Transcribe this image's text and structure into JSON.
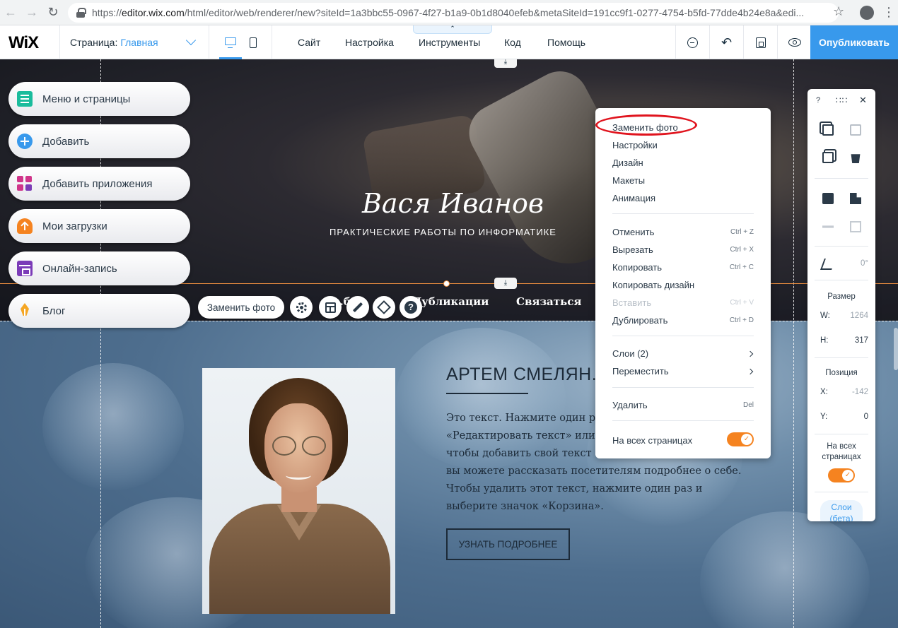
{
  "browser": {
    "url_scheme": "https://",
    "url_host": "editor.wix.com",
    "url_path": "/html/editor/web/renderer/new?siteId=1a3bbc55-0967-4f27-b1a9-0b1d8040efeb&metaSiteId=191cc9f1-0277-4754-b5fd-77dde4b24e8a&edi..."
  },
  "topbar": {
    "logo": "WiX",
    "page_label": "Страница:",
    "page_name": "Главная",
    "pull_tab": "⌃",
    "menu": [
      "Сайт",
      "Настройка",
      "Инструменты",
      "Код",
      "Помощь"
    ],
    "publish_label": "Опубликовать"
  },
  "sidebar": {
    "items": [
      {
        "label": "Меню и страницы",
        "icon": "pages-icon"
      },
      {
        "label": "Добавить",
        "icon": "plus-icon"
      },
      {
        "label": "Добавить приложения",
        "icon": "apps-icon"
      },
      {
        "label": "Мои загрузки",
        "icon": "upload-icon"
      },
      {
        "label": "Онлайн-запись",
        "icon": "calendar-icon"
      },
      {
        "label": "Блог",
        "icon": "pen-nib-icon"
      }
    ]
  },
  "site": {
    "title": "Вася Иванов",
    "tagline": "ПРАКТИЧЕСКИЕ РАБОТЫ ПО ИНФОРМАТИКЕ",
    "nav": [
      "...бо...",
      "Публикации",
      "Связаться"
    ],
    "person_name": "АРТЕМ СМЕЛЯН...",
    "about_lines": [
      "Это текст. Нажмите один раз...",
      "«Редактировать текст» или ...",
      "чтобы добавить свой текст ...",
      "вы можете рассказать посетителям подробнее о себе.",
      "Чтобы удалить этот текст, нажмите один раз и",
      "выберите значок «Корзина»."
    ],
    "learn_more": "УЗНАТЬ ПОДРОБНЕЕ"
  },
  "toolbar": {
    "replace_photo": "Заменить фото",
    "help_glyph": "?"
  },
  "anchor_glyph": "⤓",
  "context_menu": {
    "group1": [
      "Заменить фото",
      "Настройки",
      "Дизайн",
      "Макеты",
      "Анимация"
    ],
    "group2": [
      {
        "label": "Отменить",
        "shortcut": "Ctrl + Z"
      },
      {
        "label": "Вырезать",
        "shortcut": "Ctrl + X"
      },
      {
        "label": "Копировать",
        "shortcut": "Ctrl + C"
      },
      {
        "label": "Копировать дизайн",
        "shortcut": ""
      },
      {
        "label": "Вставить",
        "shortcut": "Ctrl + V"
      },
      {
        "label": "Дублировать",
        "shortcut": "Ctrl + D"
      }
    ],
    "layers": "Слои (2)",
    "move": "Переместить",
    "delete": {
      "label": "Удалить",
      "shortcut": "Del"
    },
    "all_pages": "На всех страницах",
    "all_pages_on": true
  },
  "inspector": {
    "help": "?",
    "grip": "∷∷",
    "close": "✕",
    "angle": "0°",
    "size_label": "Размер",
    "w_label": "W:",
    "w_value": "1264",
    "h_label": "H:",
    "h_value": "317",
    "pos_label": "Позиция",
    "x_label": "X:",
    "x_value": "-142",
    "y_label": "Y:",
    "y_value": "0",
    "all_pages_line1": "На всех",
    "all_pages_line2": "страницах",
    "layers_line1": "Слои",
    "layers_line2": "(бета)"
  },
  "colors": {
    "accent": "#3899ec",
    "selection": "#f09040",
    "toggle": "#f58320",
    "highlight": "#e0141e"
  }
}
